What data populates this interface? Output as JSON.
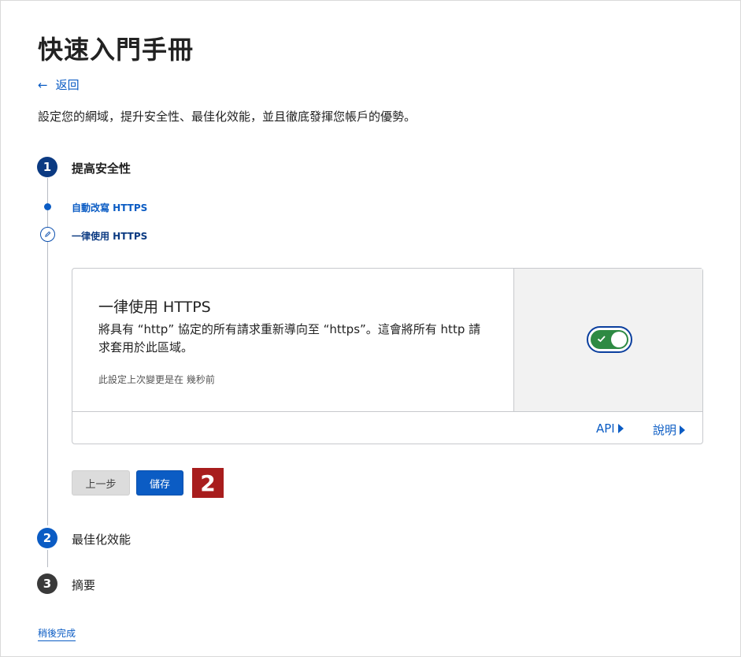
{
  "page": {
    "title": "快速入門手冊",
    "back_label": "返回",
    "intro": "設定您的網域，提升安全性、最佳化效能，並且徹底發揮您帳戶的優勢。"
  },
  "steps": [
    {
      "number": "1",
      "label": "提高安全性",
      "state": "active"
    },
    {
      "number": "2",
      "label": "最佳化效能",
      "state": "pending"
    },
    {
      "number": "3",
      "label": "摘要",
      "state": "upcoming"
    }
  ],
  "substeps": [
    {
      "label": "自動改寫 HTTPS",
      "state": "done"
    },
    {
      "label": "一律使用 HTTPS",
      "state": "current"
    }
  ],
  "card": {
    "title": "一律使用 HTTPS",
    "description": "將具有 “http” 協定的所有請求重新導向至 “https”。這會將所有 http 請求套用於此區域。",
    "meta": "此設定上次變更是在 幾秒前",
    "toggle_on": true,
    "links": {
      "api": "API",
      "help": "說明"
    }
  },
  "buttons": {
    "prev": "上一步",
    "save": "儲存"
  },
  "marker": "2",
  "finish_later": "稍後完成",
  "colors": {
    "accent": "#0b5cc4",
    "step_active": "#0b3a82",
    "step_pending": "#0b5cc4",
    "step_upcoming": "#3a3a3a",
    "toggle_on": "#2e8a43",
    "marker": "#a81d1d"
  },
  "icons": {
    "back": "arrow-left-icon",
    "substep_edit": "pencil-icon",
    "toggle_check": "check-icon",
    "link_arrow": "triangle-right-icon"
  }
}
